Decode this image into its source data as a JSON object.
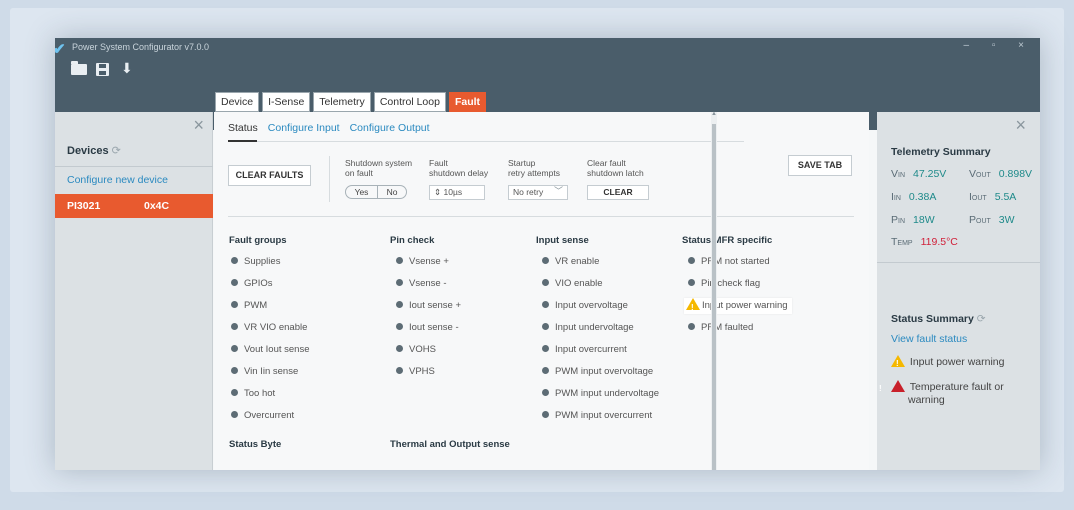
{
  "window": {
    "title": "Power System Configurator v7.0.0",
    "controls": "– ▫ ×"
  },
  "toolbar": {
    "icons": [
      "folder-icon",
      "save-icon",
      "download-icon"
    ]
  },
  "tabs": [
    {
      "label": "Device",
      "active": false
    },
    {
      "label": "I-Sense",
      "active": false
    },
    {
      "label": "Telemetry",
      "active": false
    },
    {
      "label": "Control Loop",
      "active": false
    },
    {
      "label": "Fault",
      "active": true
    }
  ],
  "sidebar": {
    "heading": "Devices",
    "configure_link": "Configure new device",
    "device": {
      "name": "PI3021",
      "address": "0x4C"
    }
  },
  "subtabs": [
    {
      "label": "Status",
      "active": true
    },
    {
      "label": "Configure Input",
      "active": false
    },
    {
      "label": "Configure Output",
      "active": false
    }
  ],
  "controls": {
    "clear_faults": "CLEAR FAULTS",
    "save_tab": "SAVE TAB",
    "shutdown_label": [
      "Shutdown system",
      "on fault"
    ],
    "yes": "Yes",
    "no": "No",
    "delay_label": [
      "Fault",
      "shutdown delay"
    ],
    "delay_value": "10µs",
    "retry_label": [
      "Startup",
      "retry attempts"
    ],
    "retry_value": "No retry",
    "latch_label": [
      "Clear fault",
      "shutdown latch"
    ],
    "latch_button": "CLEAR"
  },
  "columns": [
    {
      "title": "Fault groups",
      "items": [
        "Supplies",
        "GPIOs",
        "PWM",
        "VR VIO enable",
        "Vout Iout sense",
        "Vin Iin sense",
        "Too hot",
        "Overcurrent"
      ]
    },
    {
      "title": "Pin check",
      "items": [
        "Vsense +",
        "Vsense -",
        "Iout sense +",
        "Iout sense -",
        "VOHS",
        "VPHS"
      ]
    },
    {
      "title": "Input sense",
      "items": [
        "VR enable",
        "VIO enable",
        "Input overvoltage",
        "Input undervoltage",
        "Input overcurrent",
        "PWM input overvoltage",
        "PWM input undervoltage",
        "PWM input overcurrent"
      ]
    },
    {
      "title": "Status MFR specific",
      "items": [
        "PRM not started",
        "Pin check flag",
        "Input power warning",
        "PRM faulted"
      ]
    }
  ],
  "sections_below": [
    "Status Byte",
    "Thermal and Output sense"
  ],
  "telemetry": {
    "heading": "Telemetry Summary",
    "vin_label": "Vin",
    "vin": "47.25V",
    "vout_label": "Vout",
    "vout": "0.898V",
    "iin_label": "Iin",
    "iin": "0.38A",
    "iout_label": "Iout",
    "iout": "5.5A",
    "pin_label": "Pin",
    "pin": "18W",
    "pout_label": "Pout",
    "pout": "3W",
    "temp_label": "Temp",
    "temp": "119.5°C"
  },
  "status_summary": {
    "heading": "Status Summary",
    "link": "View fault status",
    "warning": "Input power warning",
    "fault": "Temperature fault or warning"
  },
  "colors": {
    "accent": "#e85a2f",
    "link": "#2b8ac0",
    "value": "#1f8a8a",
    "alert": "#d0213a",
    "warn": "#f5b800"
  }
}
